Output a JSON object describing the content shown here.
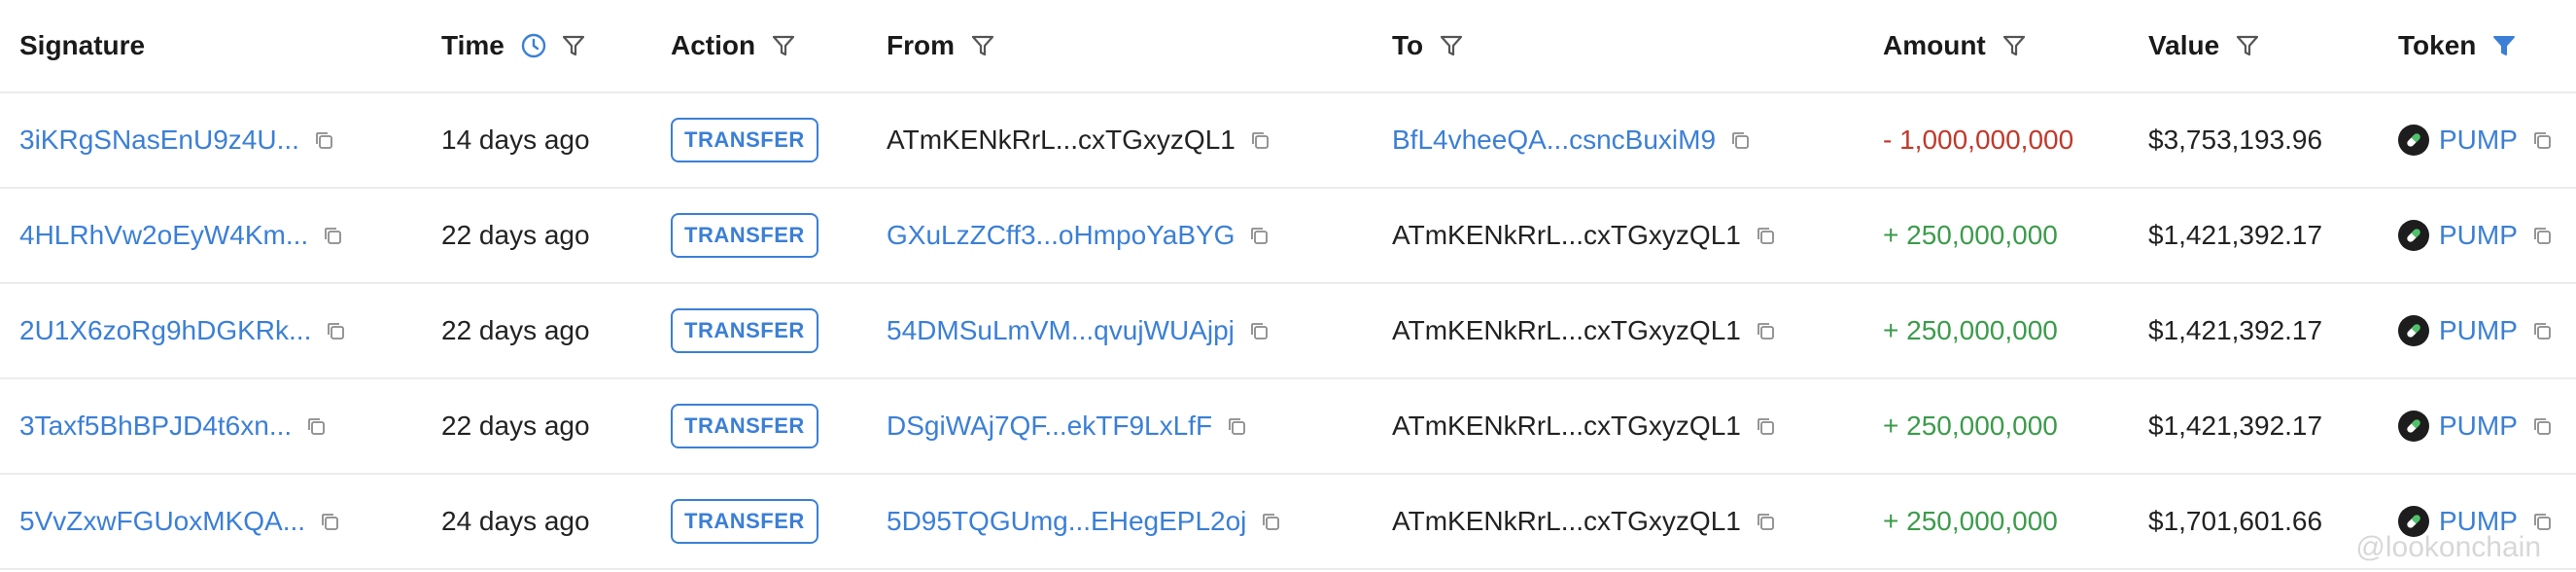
{
  "columns": {
    "signature": "Signature",
    "time": "Time",
    "action": "Action",
    "from": "From",
    "to": "To",
    "amount": "Amount",
    "value": "Value",
    "token": "Token"
  },
  "icons": {
    "filter": "filter-icon",
    "filter_active": "filter-active-icon",
    "clock": "clock-icon",
    "copy": "copy-icon",
    "token_logo": "pump-pill-icon"
  },
  "colors": {
    "link": "#3b7fd6",
    "negative": "#c0392b",
    "positive": "#3c9b4b",
    "filter_active": "#3b7fd6"
  },
  "rows": [
    {
      "signature": "3iKRgSNasEnU9z4U...",
      "time": "14 days ago",
      "action": "TRANSFER",
      "from": "ATmKENkRrL...cxTGxyzQL1",
      "to": "BfL4vheeQA...csncBuxiM9",
      "amount": "- 1,000,000,000",
      "value": "$3,753,193.96",
      "token": "PUMP"
    },
    {
      "signature": "4HLRhVw2oEyW4Km...",
      "time": "22 days ago",
      "action": "TRANSFER",
      "from": "GXuLzZCff3...oHmpoYaBYG",
      "to": "ATmKENkRrL...cxTGxyzQL1",
      "amount": "+ 250,000,000",
      "value": "$1,421,392.17",
      "token": "PUMP"
    },
    {
      "signature": "2U1X6zoRg9hDGKRk...",
      "time": "22 days ago",
      "action": "TRANSFER",
      "from": "54DMSuLmVM...qvujWUAjpj",
      "to": "ATmKENkRrL...cxTGxyzQL1",
      "amount": "+ 250,000,000",
      "value": "$1,421,392.17",
      "token": "PUMP"
    },
    {
      "signature": "3Taxf5BhBPJD4t6xn...",
      "time": "22 days ago",
      "action": "TRANSFER",
      "from": "DSgiWAj7QF...ekTF9LxLfF",
      "to": "ATmKENkRrL...cxTGxyzQL1",
      "amount": "+ 250,000,000",
      "value": "$1,421,392.17",
      "token": "PUMP"
    },
    {
      "signature": "5VvZxwFGUoxMKQA...",
      "time": "24 days ago",
      "action": "TRANSFER",
      "from": "5D95TQGUmg...EHegEPL2oj",
      "to": "ATmKENkRrL...cxTGxyzQL1",
      "amount": "+ 250,000,000",
      "value": "$1,701,601.66",
      "token": "PUMP"
    }
  ],
  "watermark": "@lookonchain"
}
